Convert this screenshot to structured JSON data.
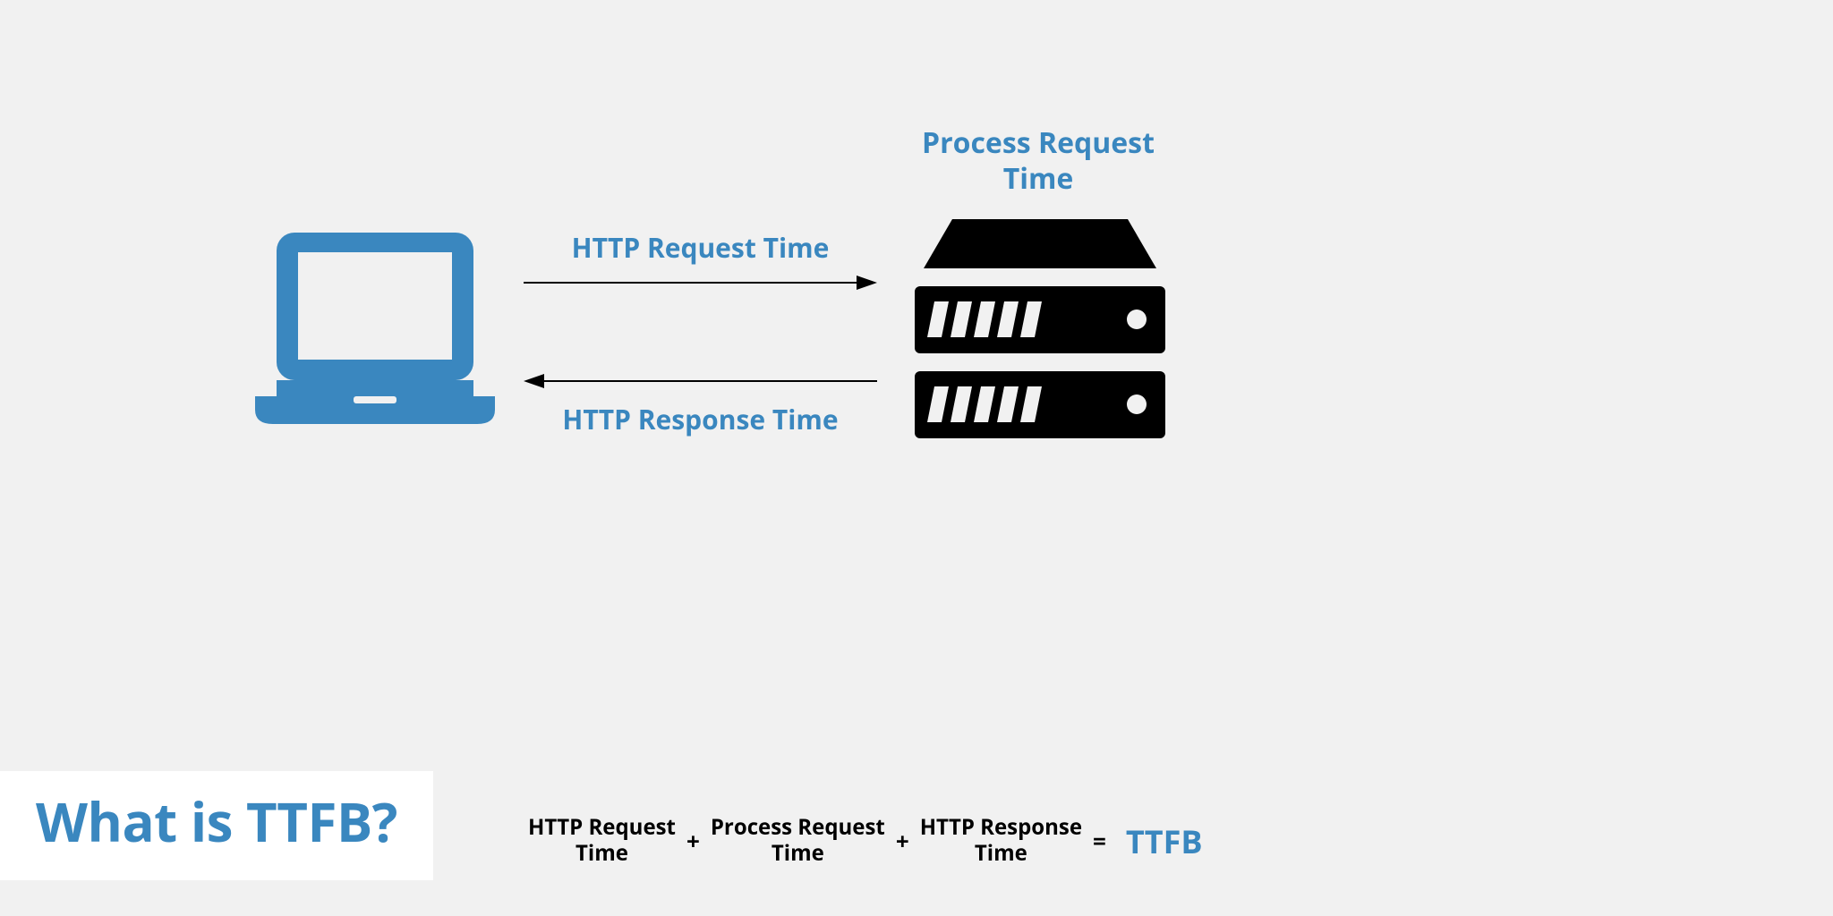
{
  "title": "What is TTFB?",
  "server_label": "Process Request Time",
  "request_label": "HTTP Request Time",
  "response_label": "HTTP Response Time",
  "equation": {
    "term1_line1": "HTTP Request",
    "term1_line2": "Time",
    "op1": "+",
    "term2_line1": "Process Request",
    "term2_line2": "Time",
    "op2": "+",
    "term3_line1": "HTTP Response",
    "term3_line2": "Time",
    "op3": "=",
    "result": "TTFB"
  },
  "colors": {
    "blue": "#3a87bf",
    "black": "#000000"
  }
}
